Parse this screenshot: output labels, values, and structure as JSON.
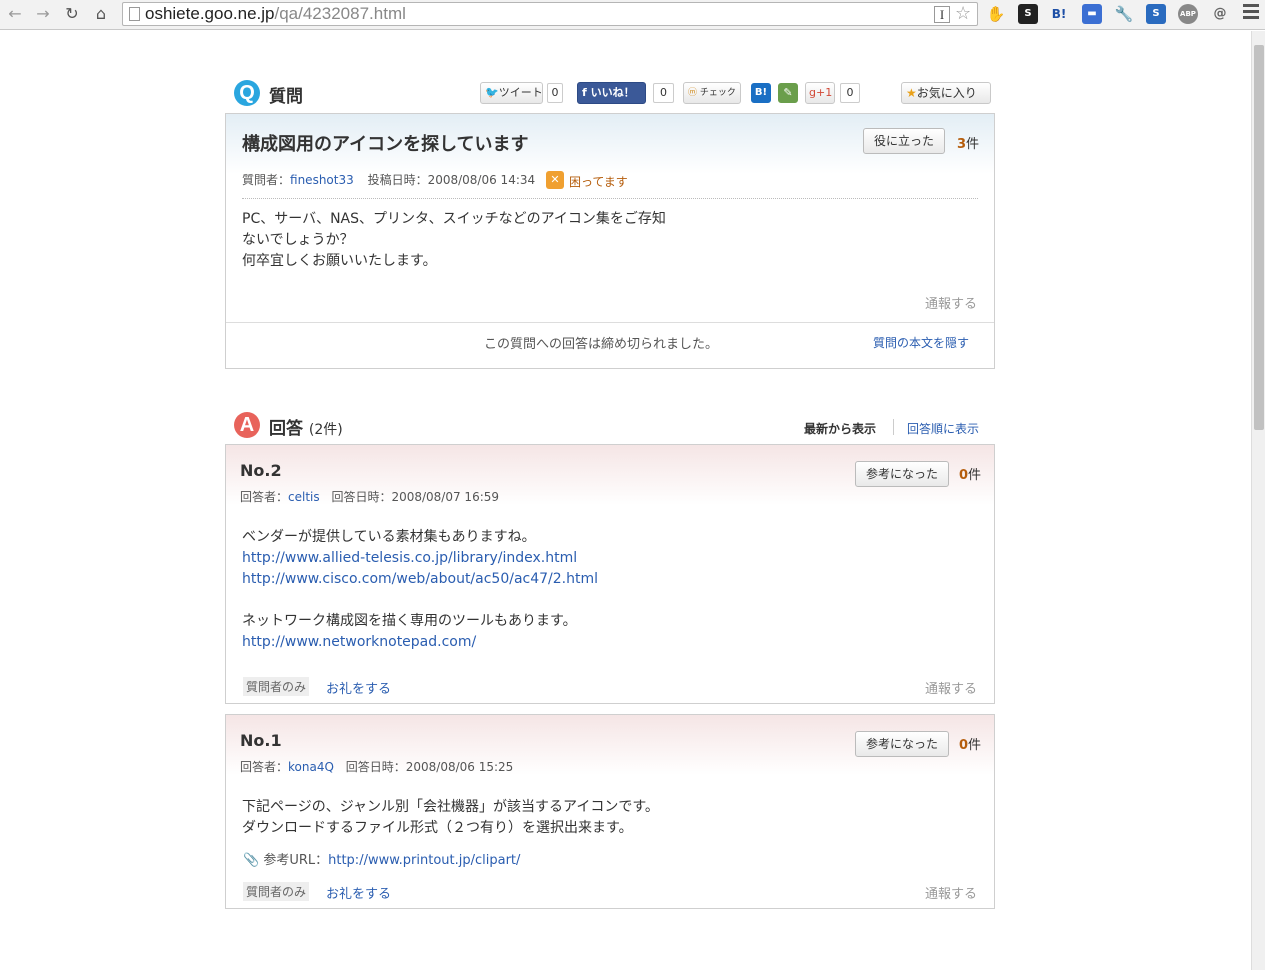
{
  "browser": {
    "url_host": "oshiete.goo.ne.jp",
    "url_path": "/qa/4232087.html"
  },
  "share": {
    "tweet_label": "ツイート",
    "tweet_count": "0",
    "like_label": "いいね！",
    "like_count": "0",
    "check_label": "チェック",
    "hatena_label": "B!",
    "gplus_label": "+1",
    "gplus_count": "0",
    "favorite_label": "お気に入り"
  },
  "question": {
    "section_badge": "Q",
    "section_title": "質問",
    "title": "構成図用のアイコンを探しています",
    "helpful_button": "役に立った",
    "helpful_count": "3",
    "helpful_unit": "件",
    "asker_label": "質問者：",
    "asker_name": "fineshot33",
    "posted_label": "投稿日時：2008/08/06 14:34",
    "status": "困ってます",
    "body": [
      "PC、サーバ、NAS、プリンタ、スイッチなどのアイコン集をご存知",
      "ないでしょうか？",
      "何卒宜しくお願いいたします。"
    ],
    "report": "通報する",
    "closed_notice": "この質問への回答は締め切られました。",
    "hide_body": "質問の本文を隠す"
  },
  "answers_section": {
    "badge": "A",
    "title": "回答",
    "count": "(2件)",
    "sort_newest": "最新から表示",
    "sort_order": "回答順に表示"
  },
  "answers": [
    {
      "number": "No.2",
      "helpful_button": "参考になった",
      "helpful_count": "0",
      "helpful_unit": "件",
      "answerer_label": "回答者：",
      "answerer_name": "celtis",
      "answered_label": "回答日時：2008/08/07 16:59",
      "line1": "ベンダーが提供している素材集もありますね。",
      "link1": "http://www.allied-telesis.co.jp/library/index.html",
      "link2": "http://www.cisco.com/web/about/ac50/ac47/2.html",
      "line2": "ネットワーク構成図を描く専用のツールもあります。",
      "link3": "http://www.networknotepad.com/",
      "tag": "質問者のみ",
      "thanks": "お礼をする",
      "report": "通報する"
    },
    {
      "number": "No.1",
      "helpful_button": "参考になった",
      "helpful_count": "0",
      "helpful_unit": "件",
      "answerer_label": "回答者：",
      "answerer_name": "kona4Q",
      "answered_label": "回答日時：2008/08/06 15:25",
      "line1": "下記ページの、ジャンル別「会社機器」が該当するアイコンです。",
      "line2": "ダウンロードするファイル形式（２つ有り）を選択出来ます。",
      "ref_label": "参考URL：",
      "ref_url": "http://www.printout.jp/clipart/",
      "tag": "質問者のみ",
      "thanks": "お礼をする",
      "report": "通報する"
    }
  ]
}
